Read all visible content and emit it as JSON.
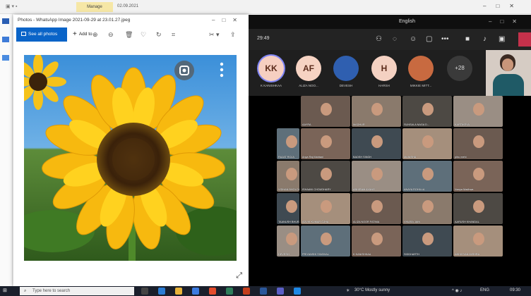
{
  "explorer": {
    "manage_tab": "Manage",
    "folder": "02.09.2021"
  },
  "photos": {
    "title": "Photos - WhatsApp Image 2021-09-29 at 23.01.27.jpeg",
    "see_all": "See all photos",
    "add_to": "Add to",
    "image_subject": "sunflower-photo"
  },
  "teams": {
    "language": "English",
    "timer": "29:49",
    "avatars": [
      {
        "initials": "KK",
        "name": "K KANISHKAA",
        "color": "#f6cfc1"
      },
      {
        "initials": "AF",
        "name": "ALIZA NOO...",
        "color": "#f6d3c3"
      },
      {
        "initials": "",
        "name": "DEVESH",
        "color": "#2f5fb0"
      },
      {
        "initials": "H",
        "name": "HARSH",
        "color": "#f4d1c2"
      },
      {
        "initials": "",
        "name": "MIKKIE MITT...",
        "color": "#c86a40"
      }
    ],
    "more_count": "+28",
    "tiles": [
      "AAYRA",
      "MADHUR",
      "SUNSALA NAGA D...",
      "KARTIKEYA",
      "RAJAT ROJA",
      "Anya Raj Mahtani",
      "BADSH SINGH",
      "MANISHA",
      "pihu mehi",
      "VIDHAN BHOLOKARA",
      "ISHAANI CHOUDHARY",
      "ABHIRAM AYANG",
      "ANAYA ROHILLA",
      "Nanya Madhwa",
      "TAANUSH BHURANA",
      "ADVIK KUMAR OJHA",
      "ALIZA NOOR FATIMA",
      "VIKARA JAIN",
      "AARUSH KHANDAL",
      "DEVESH",
      "PRIYANSHI SINGHAL",
      "K KANISHKAA",
      "SIDDHARTH",
      "ABHIGYAN MISHRA"
    ]
  },
  "taskbar": {
    "search_placeholder": "Type here to search",
    "weather": "30°C  Mostly sunny",
    "lang": "ENG",
    "time": "09:30"
  }
}
